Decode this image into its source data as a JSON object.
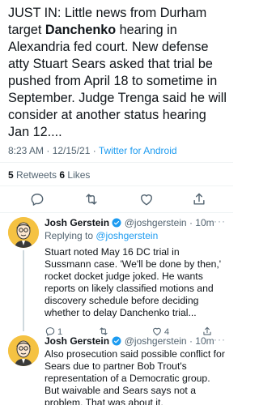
{
  "tweet": {
    "text_part1": "JUST IN: Little news from Durham target ",
    "text_bold": "Danchenko",
    "text_part2": " hearing in Alexandria fed court. New defense atty Stuart Sears asked that trial be pushed from April 18 to sometime in September. Judge Trenga said he will consider at another status hearing Jan 12....",
    "timestamp": "8:23 AM · 12/15/21 · ",
    "source": "Twitter for Android",
    "retweets_count": "5",
    "retweets_label": " Retweets ",
    "likes_count": "6",
    "likes_label": " Likes"
  },
  "replies": [
    {
      "name": "Josh Gerstein",
      "handle": "@joshgerstein · 10m",
      "replying_prefix": "Replying to ",
      "replying_to": "@joshgerstein",
      "text": "Stuart noted May 16 DC trial in Sussmann case. 'We'll be done by then,' rocket docket judge joked. He wants reports on likely classified motions and discovery schedule before deciding whether to delay Danchenko trial...",
      "reply_count": "1",
      "retweet_count": "",
      "like_count": "4"
    },
    {
      "name": "Josh Gerstein",
      "handle": "@joshgerstein · 10m",
      "text": "Also prosecution said possible conflict for Sears due to partner Bob Trout's representation of a Democratic group. But waivable and Sears says not a problem. That was about it."
    }
  ],
  "icons": {
    "reply": "reply-icon",
    "retweet": "retweet-icon",
    "like": "heart-icon",
    "share": "share-icon",
    "verified": "verified-badge-icon",
    "more": "more-icon"
  },
  "colors": {
    "accent": "#1d9bf0",
    "text": "#0f1419",
    "secondary": "#536471"
  }
}
